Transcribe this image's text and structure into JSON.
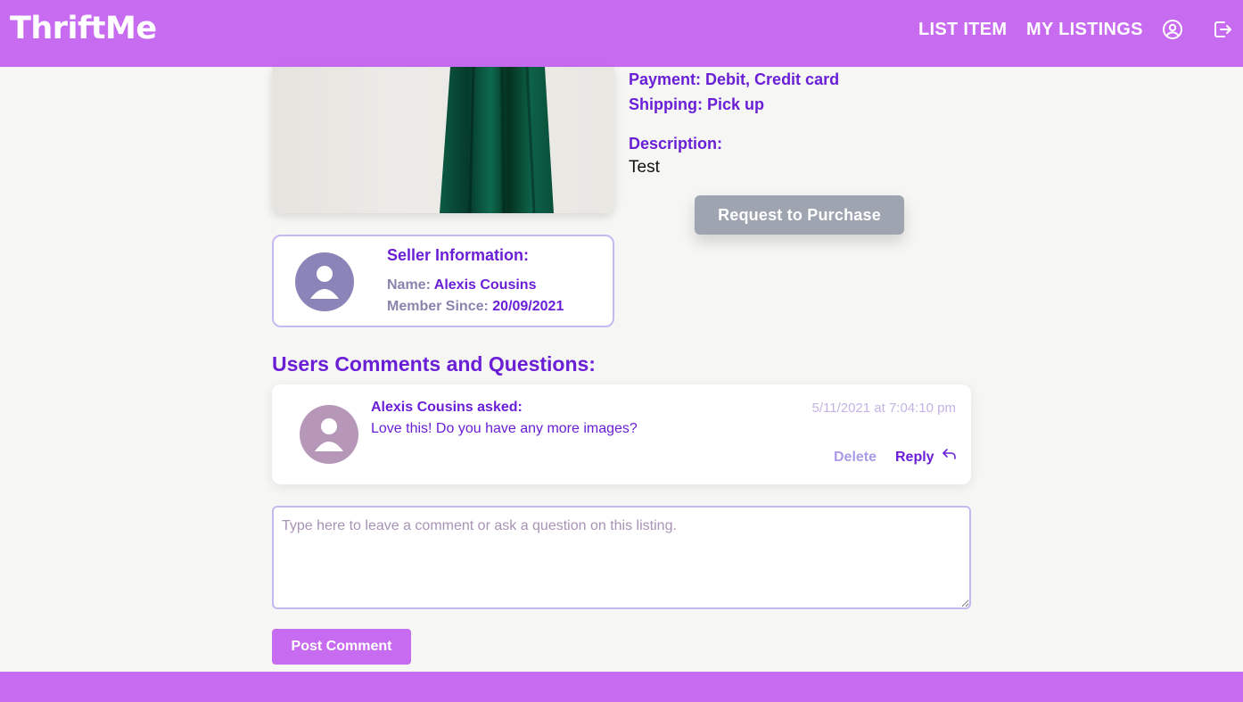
{
  "app": {
    "logo": "ThriftMe"
  },
  "nav": {
    "list_item": "LIST ITEM",
    "my_listings": "MY LISTINGS",
    "profile_icon": "user-circle-icon",
    "logout_icon": "logout-icon"
  },
  "listing": {
    "payment_label": "Payment:",
    "payment_value": "Debit, Credit card",
    "shipping_label": "Shipping:",
    "shipping_value": "Pick up",
    "description_label": "Description:",
    "description_text": "Test",
    "purchase_button": "Request to Purchase"
  },
  "seller": {
    "title": "Seller Information:",
    "name_label": "Name:",
    "name_value": "Alexis Cousins",
    "since_label": "Member Since:",
    "since_value": "20/09/2021"
  },
  "comments": {
    "heading": "Users Comments and Questions:",
    "items": [
      {
        "author_line": "Alexis Cousins asked:",
        "text": "Love this! Do you have any more images?",
        "timestamp": "5/11/2021 at 7:04:10 pm",
        "delete_label": "Delete",
        "reply_label": "Reply"
      }
    ],
    "input_placeholder": "Type here to leave a comment or ask a question on this listing.",
    "post_button": "Post Comment"
  },
  "colors": {
    "brand": "#c76cf0",
    "accent_text": "#6a1fd6",
    "muted_text": "#8a84ad",
    "disabled_button": "#9ea4b0",
    "background": "#f6f6f4"
  }
}
